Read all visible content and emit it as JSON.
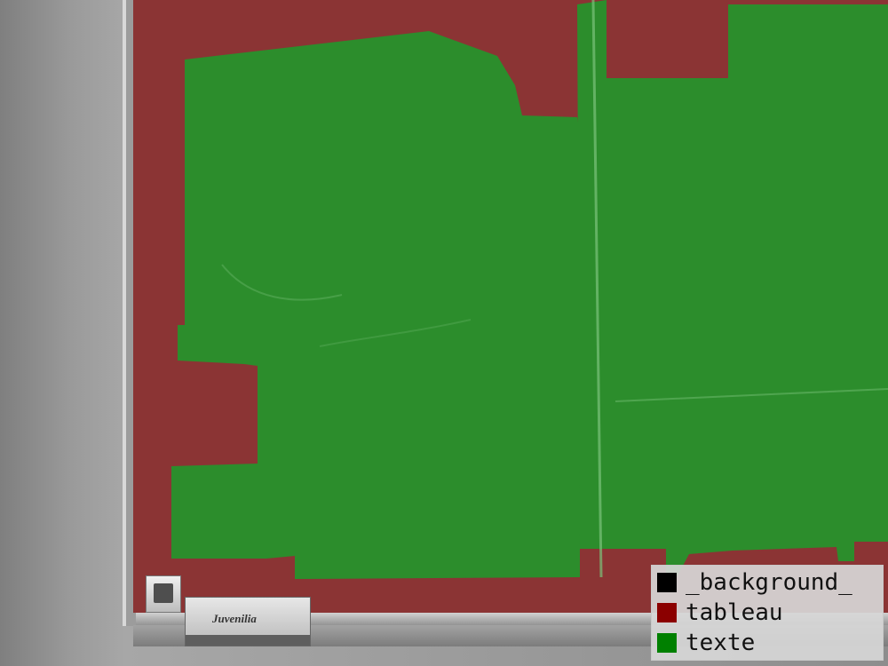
{
  "scene": {
    "colors": {
      "background": "#000000",
      "tableau": "#8b0000",
      "texte": "#008000"
    }
  },
  "legend": {
    "items": [
      {
        "label": "_background_",
        "color": "#000000"
      },
      {
        "label": "tableau",
        "color": "#8b0000"
      },
      {
        "label": "texte",
        "color": "#008000"
      }
    ]
  },
  "eraser": {
    "brand": "Juvenilia"
  }
}
